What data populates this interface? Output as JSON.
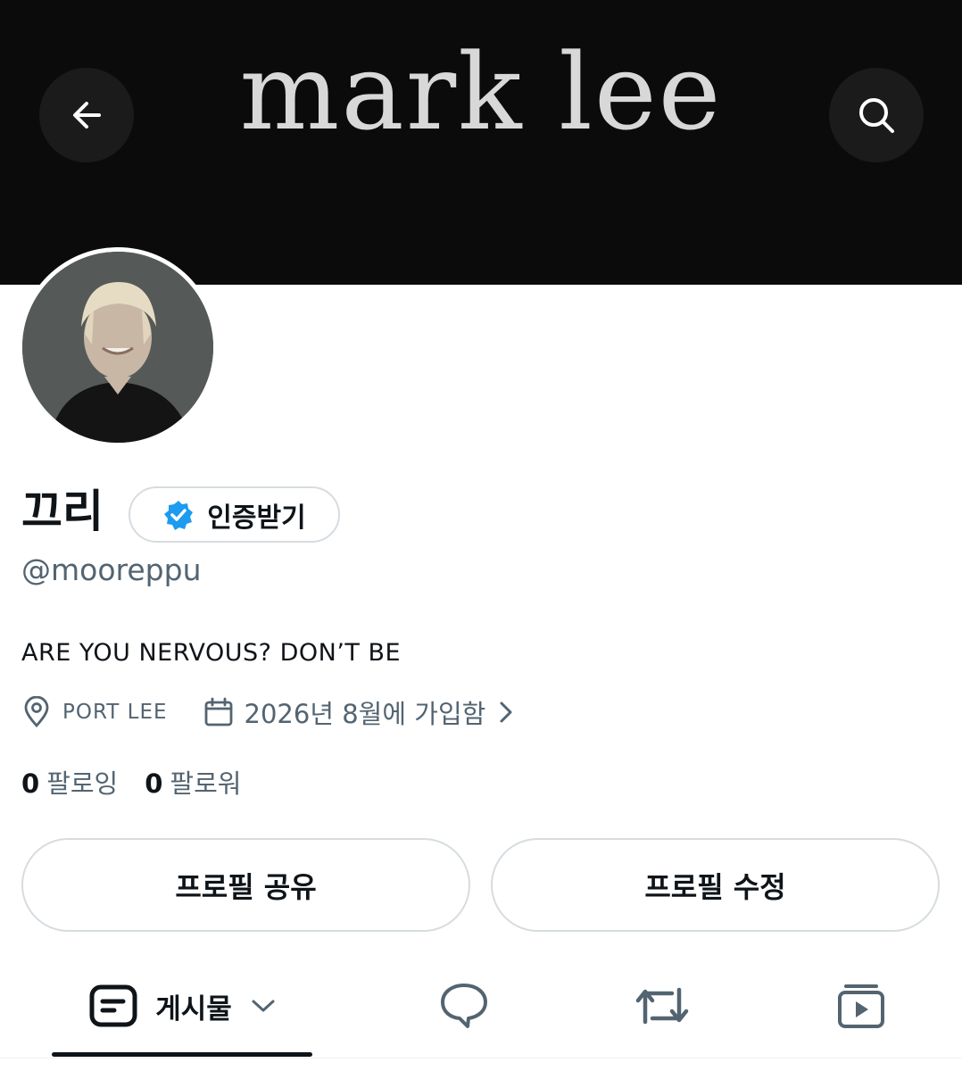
{
  "banner": {
    "text": "mark lee"
  },
  "header": {
    "back_icon": "arrow-left-icon",
    "search_icon": "search-icon"
  },
  "profile": {
    "display_name": "끄리",
    "verify_label": "인증받기",
    "handle": "@mooreppu",
    "bio": "ARE YOU NERVOUS? DON’T BE",
    "location": "PORT LEE",
    "joined": "2026년 8월에 가입함",
    "following_count": "0",
    "following_label": "팔로잉",
    "followers_count": "0",
    "followers_label": "팔로워"
  },
  "actions": {
    "share_label": "프로필 공유",
    "edit_label": "프로필 수정"
  },
  "tabs": {
    "posts_label": "게시물",
    "active": "posts",
    "icons": [
      "posts-icon",
      "reply-icon",
      "repost-icon",
      "media-icon"
    ]
  },
  "colors": {
    "banner_bg": "#0b0b0b",
    "verified_blue": "#1d9bf0",
    "secondary_text": "#536471",
    "border": "#d6dce0"
  }
}
